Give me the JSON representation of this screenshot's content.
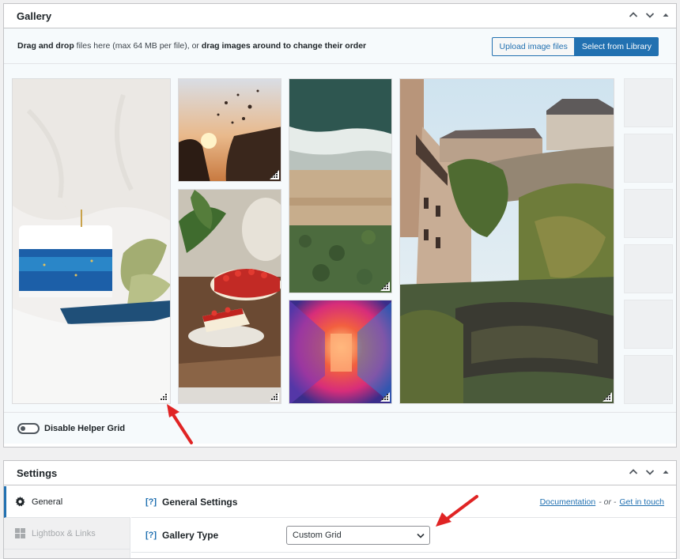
{
  "gallery": {
    "title": "Gallery",
    "drop_prefix": "Drag and drop",
    "drop_middle": " files here (max 64 MB per file), or ",
    "drop_suffix": "drag images around to change their order",
    "upload_button": "Upload image files",
    "library_button": "Select from Library",
    "helper_grid_label": "Disable Helper Grid",
    "images": [
      {
        "subject": "white cake with blue frosting and crescent moon topper"
      },
      {
        "subject": "sunset wave splashing on rocks"
      },
      {
        "subject": "strawberry cheesecake on wooden table"
      },
      {
        "subject": "aerial view of beach and ocean waves"
      },
      {
        "subject": "neon pink and orange corridor"
      },
      {
        "subject": "old town buildings above river valley"
      }
    ]
  },
  "settings": {
    "title": "Settings",
    "tabs": [
      {
        "label": "General",
        "icon": "gear-icon",
        "active": true
      },
      {
        "label": "Lightbox & Links",
        "icon": "grid-icon",
        "active": false
      }
    ],
    "help_marker": "[?]",
    "section_title": "General Settings",
    "documentation_link": "Documentation",
    "or_text": "- or -",
    "contact_link": "Get in touch",
    "gallery_type_label": "Gallery Type",
    "gallery_type_value": "Custom Grid"
  },
  "colors": {
    "accent": "#2271b1",
    "annotation_arrow": "#e02424"
  }
}
